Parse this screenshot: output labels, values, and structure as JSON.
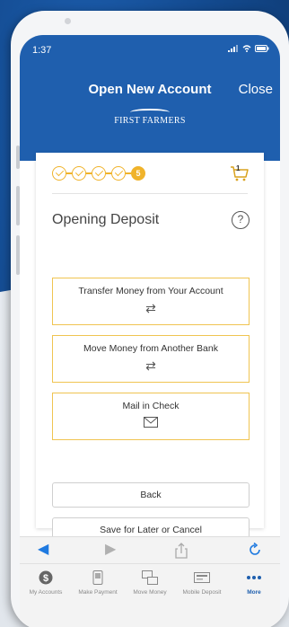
{
  "status": {
    "time": "1:37"
  },
  "nav": {
    "title": "Open New Account",
    "close": "Close"
  },
  "logo": {
    "text": "FIRST FARMERS"
  },
  "progress": {
    "completed_steps": 4,
    "current_step": "5"
  },
  "cart": {
    "count": "1"
  },
  "section": {
    "title": "Opening Deposit"
  },
  "options": [
    {
      "label": "Transfer Money from Your Account",
      "icon": "transfer-arrows-icon"
    },
    {
      "label": "Move Money from Another Bank",
      "icon": "transfer-arrows-icon"
    },
    {
      "label": "Mail in Check",
      "icon": "envelope-icon"
    }
  ],
  "buttons": {
    "back": "Back",
    "save": "Save for Later or Cancel"
  },
  "tabs": [
    {
      "label": "My Accounts",
      "icon": "dollar-coin-icon"
    },
    {
      "label": "Make Payment",
      "icon": "phone-bill-icon"
    },
    {
      "label": "Move Money",
      "icon": "transfer-icon"
    },
    {
      "label": "Mobile Deposit",
      "icon": "check-deposit-icon"
    },
    {
      "label": "More",
      "icon": "more-dots-icon"
    }
  ],
  "colors": {
    "brand_blue": "#1f5fae",
    "accent_gold": "#f0b32b",
    "option_border": "#f0c451"
  }
}
